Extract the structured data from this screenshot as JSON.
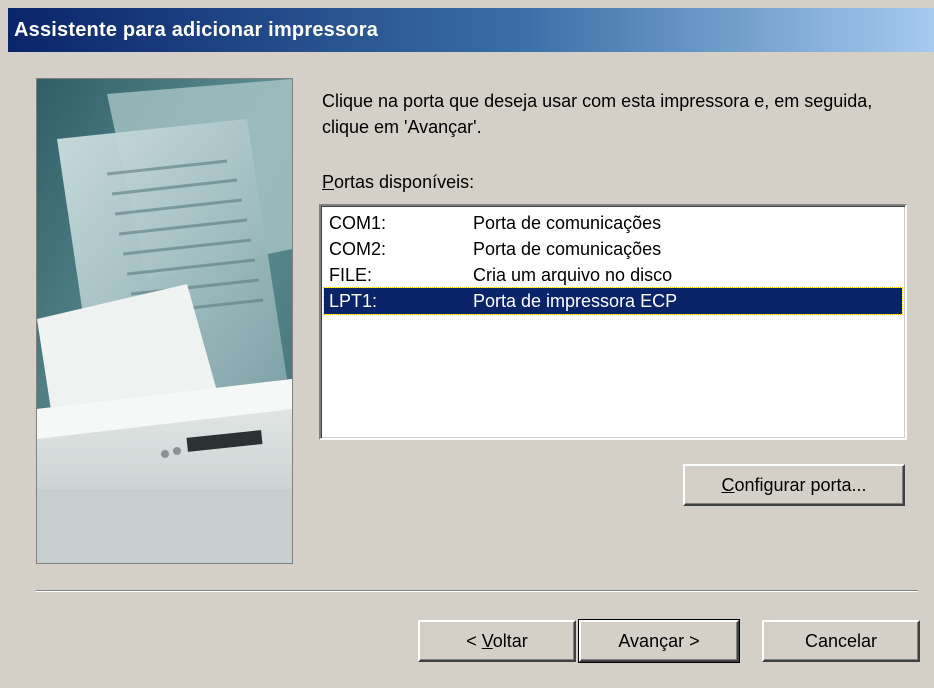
{
  "window": {
    "title": "Assistente para adicionar impressora"
  },
  "main": {
    "instruction": "Clique na porta que deseja usar com esta impressora e, em seguida, clique em 'Avançar'.",
    "ports_label_accel": "P",
    "ports_label_rest": "ortas disponíveis:",
    "ports": [
      {
        "port": "COM1:",
        "description": "Porta de comunicações",
        "selected": false
      },
      {
        "port": "COM2:",
        "description": "Porta de comunicações",
        "selected": false
      },
      {
        "port": "FILE:",
        "description": "Cria um arquivo no disco",
        "selected": false
      },
      {
        "port": "LPT1:",
        "description": "Porta de impressora ECP",
        "selected": true
      }
    ],
    "configure_accel": "C",
    "configure_rest": "onfigurar porta..."
  },
  "footer": {
    "back_prefix": "< ",
    "back_accel": "V",
    "back_rest": "oltar",
    "next_label": "Avançar >",
    "cancel_label": "Cancelar"
  },
  "colors": {
    "face": "#d4d0c8",
    "title_start": "#0a246a",
    "title_end": "#a6caf0",
    "selection": "#0a246a"
  },
  "icons": {
    "art": "printer-illustration"
  }
}
